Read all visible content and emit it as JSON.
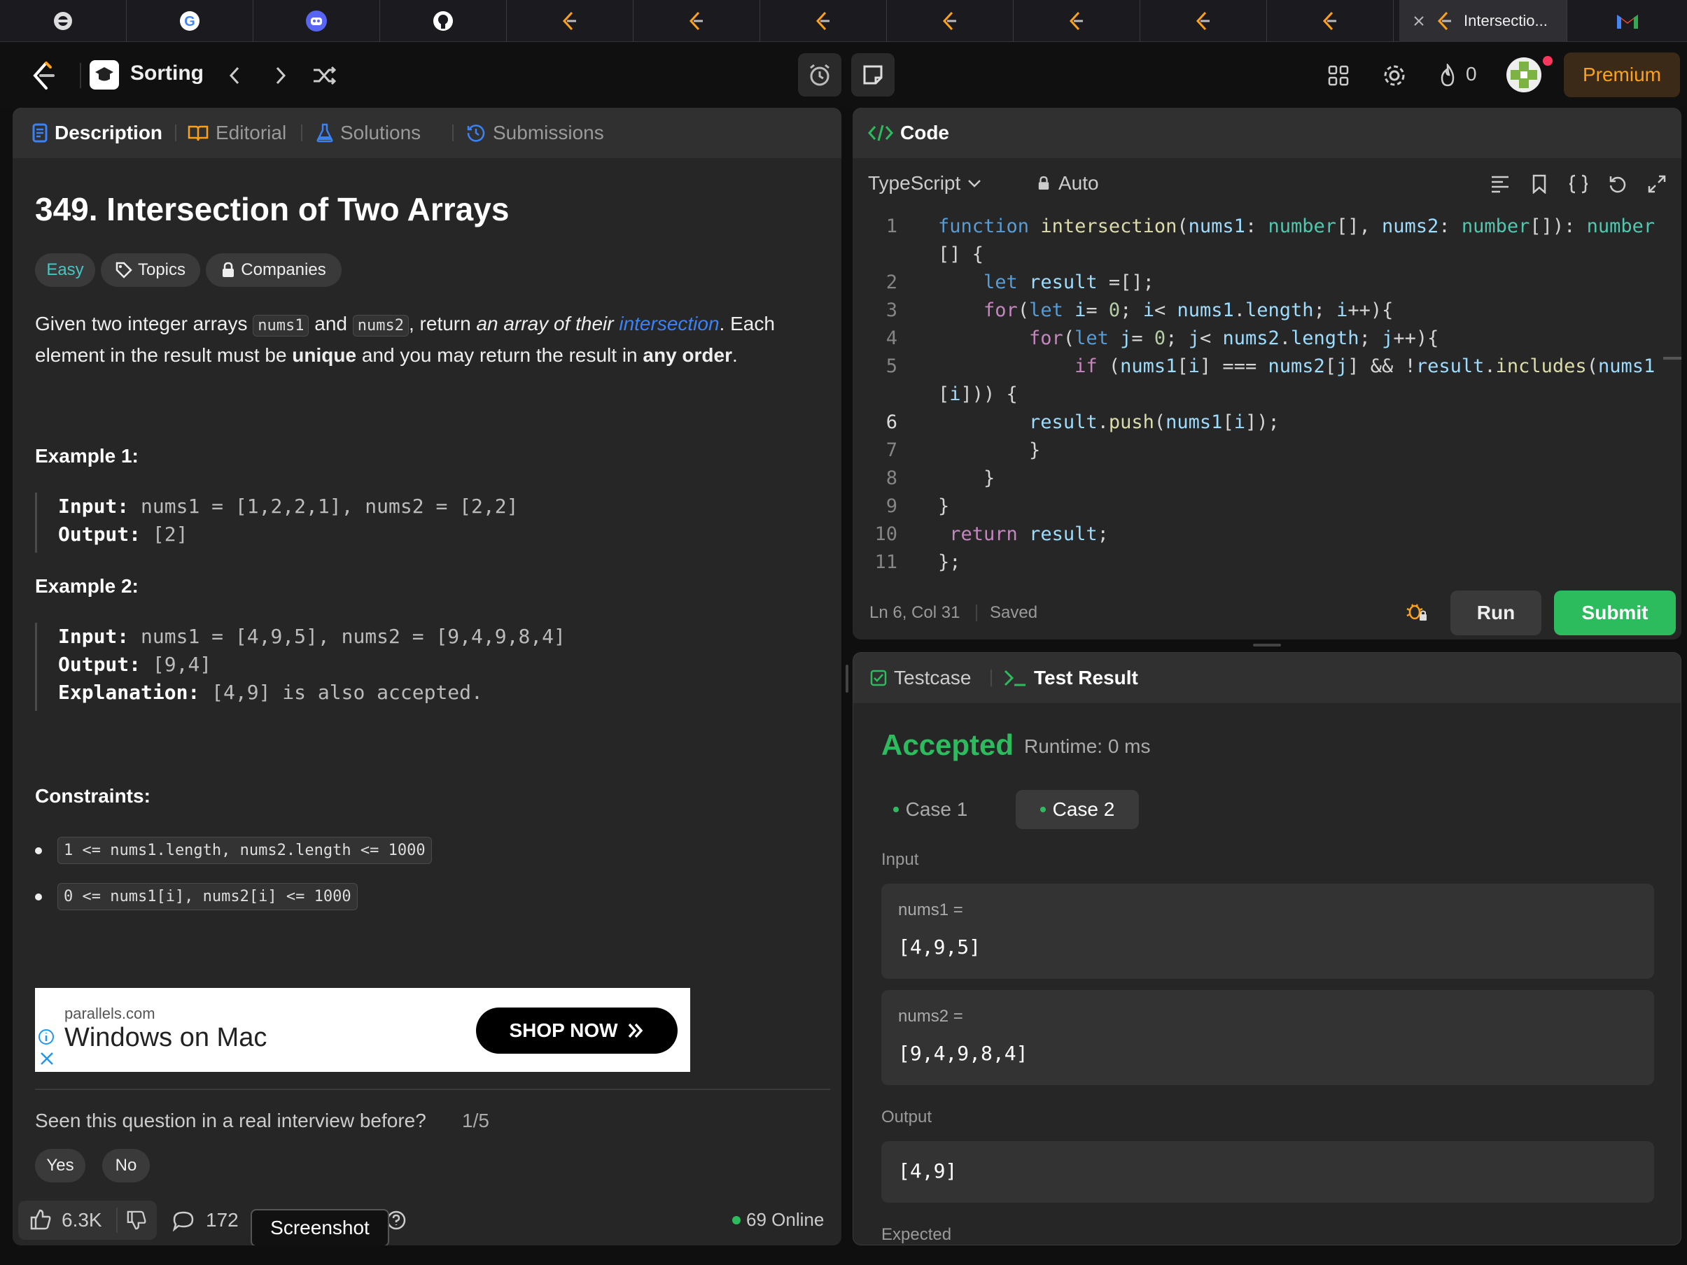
{
  "browser_tabs": {
    "active_title": "Intersectio..."
  },
  "topbar": {
    "list_title": "Sorting",
    "streak_count": "0",
    "premium_label": "Premium"
  },
  "left_panel": {
    "tabs": [
      {
        "label": "Description"
      },
      {
        "label": "Editorial"
      },
      {
        "label": "Solutions"
      },
      {
        "label": "Submissions"
      }
    ],
    "problem_title": "349. Intersection of Two Arrays",
    "difficulty": "Easy",
    "topics_label": "Topics",
    "companies_label": "Companies",
    "description": {
      "p1": "Given two integer arrays ",
      "code1": "nums1",
      "p2": " and ",
      "code2": "nums2",
      "p3": ", return ",
      "em1": "an array of their ",
      "link": "intersection",
      "p4": ". Each element in the result must be ",
      "b1": "unique",
      "p5": " and you may return the result in ",
      "b2": "any order",
      "p6": "."
    },
    "examples": [
      {
        "title": "Example 1:",
        "input_label": "Input:",
        "input_value": " nums1 = [1,2,2,1], nums2 = [2,2]",
        "output_label": "Output:",
        "output_value": " [2]"
      },
      {
        "title": "Example 2:",
        "input_label": "Input:",
        "input_value": " nums1 = [4,9,5], nums2 = [9,4,9,8,4]",
        "output_label": "Output:",
        "output_value": " [9,4]",
        "explanation_label": "Explanation:",
        "explanation_value": " [4,9] is also accepted."
      }
    ],
    "constraints_title": "Constraints:",
    "constraints": [
      "1 <= nums1.length, nums2.length <= 1000",
      "0 <= nums1[i], nums2[i] <= 1000"
    ],
    "ad": {
      "domain": "parallels.com",
      "headline": "Windows on Mac",
      "cta": "SHOP NOW"
    },
    "interview_question": "Seen this question in a real interview before?",
    "interview_progress": "1/5",
    "yes_label": "Yes",
    "no_label": "No",
    "likes": "6.3K",
    "comments": "172",
    "tooltip": "Screenshot",
    "online": "69 Online"
  },
  "code_panel": {
    "title": "Code",
    "language": "TypeScript",
    "mode": "Auto",
    "line_numbers": [
      "1",
      "2",
      "3",
      "4",
      "5",
      "6",
      "7",
      "8",
      "9",
      "10",
      "11"
    ],
    "cursor_status": "Ln 6, Col 31",
    "save_status": "Saved",
    "run_label": "Run",
    "submit_label": "Submit"
  },
  "result_panel": {
    "tabs": [
      {
        "label": "Testcase"
      },
      {
        "label": "Test Result"
      }
    ],
    "status": "Accepted",
    "runtime": "Runtime: 0 ms",
    "cases": [
      {
        "label": "Case 1"
      },
      {
        "label": "Case 2"
      }
    ],
    "input_label": "Input",
    "params": [
      {
        "name": "nums1 =",
        "value": "[4,9,5]"
      },
      {
        "name": "nums2 =",
        "value": "[9,4,9,8,4]"
      }
    ],
    "output_label": "Output",
    "output_value": "[4,9]",
    "expected_label": "Expected"
  },
  "colors": {
    "accent_orange": "#ffa116",
    "accepted_green": "#2cbb5d",
    "link_blue": "#3b82f6",
    "easy_teal": "#46c6c2"
  },
  "icons": [
    "leetcode-logo-icon",
    "google-icon",
    "discord-icon",
    "github-icon",
    "gmail-icon",
    "chevron-left-icon",
    "chevron-right-icon",
    "shuffle-icon",
    "alarm-icon",
    "note-icon",
    "grid-icon",
    "gear-icon",
    "fire-icon",
    "avatar"
  ]
}
